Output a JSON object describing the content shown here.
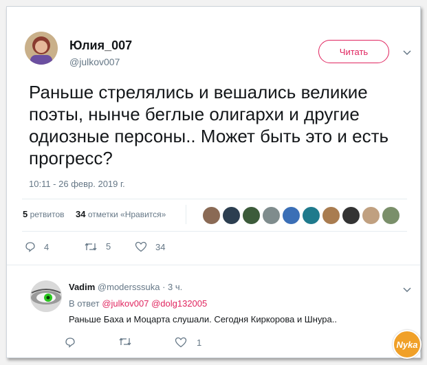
{
  "author": {
    "name": "Юлия_007",
    "handle": "@julkov007",
    "follow_label": "Читать"
  },
  "tweet": {
    "text": "Раньше стрелялись и вешались великие поэты, нынче беглые олигархи и другие одиозные персоны.. Может быть это и есть прогресс?",
    "timestamp": "10:11 - 26 февр. 2019 г."
  },
  "stats": {
    "retweets_count": "5",
    "retweets_label": "ретвитов",
    "likes_count": "34",
    "likes_label": "отметки «Нравится»"
  },
  "liker_colors": [
    "#8a6a55",
    "#2c3e50",
    "#3c5b3a",
    "#7f8c8d",
    "#3b6fb6",
    "#1f7a8c",
    "#a97c50",
    "#333333",
    "#c0a080",
    "#7a8f6a"
  ],
  "actions": {
    "replies": "4",
    "retweets": "5",
    "likes": "34"
  },
  "reply": {
    "name": "Vadim",
    "handle": "@modersssuka",
    "age": "· 3 ч.",
    "in_reply_prefix": "В ответ",
    "mention1": "@julkov007",
    "mention2": "@dolg132005",
    "text": "Раньше Баха и Моцарта слушали. Сегодня Киркорова и Шнура..",
    "likes": "1"
  },
  "watermark": "Nyka"
}
